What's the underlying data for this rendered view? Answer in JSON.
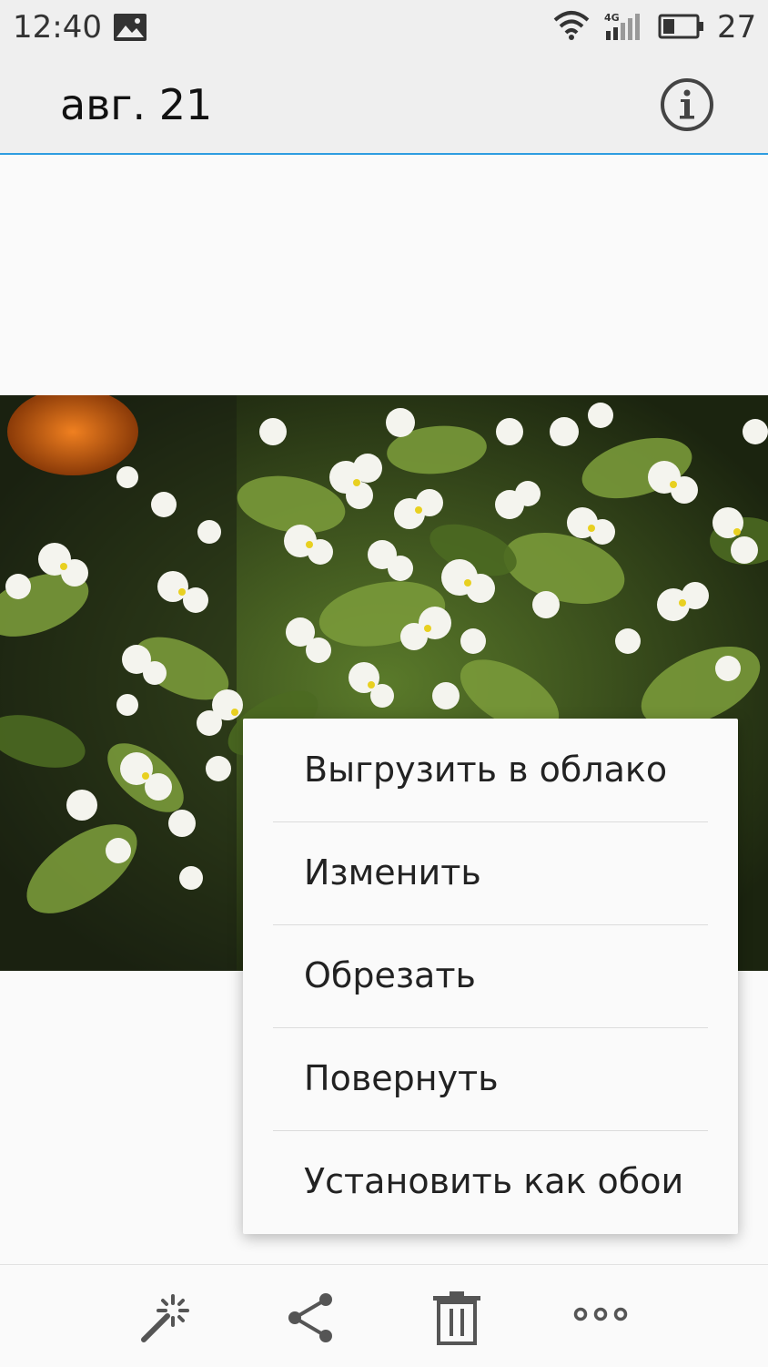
{
  "status_bar": {
    "time": "12:40",
    "network_type": "4G",
    "battery_level": "27",
    "icons": [
      "gallery-icon",
      "wifi-icon",
      "signal-icon",
      "battery-icon"
    ]
  },
  "header": {
    "title": "авг. 21",
    "info_icon": "info-icon"
  },
  "accent_color": "#2e9de0",
  "menu": {
    "items": [
      {
        "label": "Выгрузить в облако"
      },
      {
        "label": "Изменить"
      },
      {
        "label": "Обрезать"
      },
      {
        "label": "Повернуть"
      },
      {
        "label": "Установить как обои"
      }
    ]
  },
  "toolbar": {
    "icons": [
      "magic-wand-icon",
      "share-icon",
      "trash-icon",
      "more-icon"
    ]
  }
}
